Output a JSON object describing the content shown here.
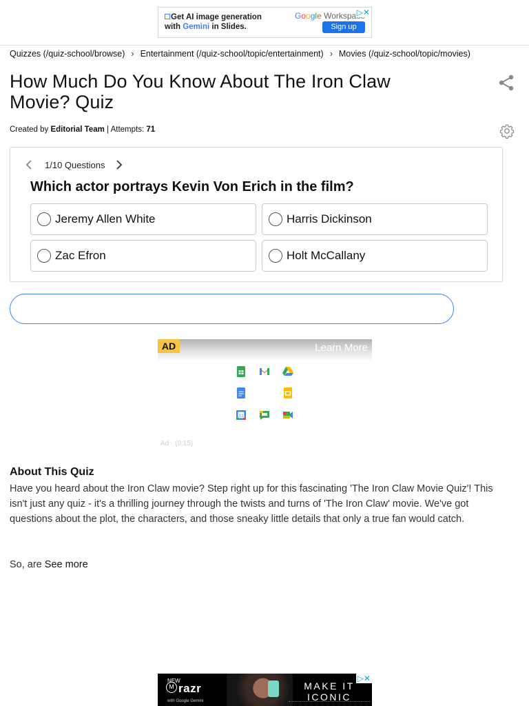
{
  "top_ad": {
    "line1": "Get AI image generation",
    "line2_a": "with ",
    "line2_gem": "Gemini",
    "line2_b": " in Slides.",
    "google_g": "G",
    "google_o1": "o",
    "google_o2": "o",
    "google_g2": "g",
    "google_l": "l",
    "google_e": "e",
    "workspace": " Workspace",
    "button": "Sign up",
    "choices": "▷✕"
  },
  "breadcrumb": {
    "items": [
      "Quizzes (/quiz-school/browse)",
      "Entertainment (/quiz-school/topic/entertainment)",
      "Movies (/quiz-school/topic/movies)"
    ],
    "separator": "›"
  },
  "title": "How Much Do You Know About The Iron Claw Movie? Quiz",
  "meta": {
    "created_by": "Created by ",
    "author": "Editorial Team",
    "attempts_label": " | Attempts: ",
    "attempts": "71"
  },
  "quiz": {
    "counter": "1/10 Questions",
    "question": "Which actor portrays Kevin Von Erich in the film?",
    "options": [
      "Jeremy Allen White",
      "Harris Dickinson",
      "Zac Efron",
      "Holt McCallany"
    ]
  },
  "video_ad": {
    "badge": "AD",
    "learn_more": "Learn More",
    "timer": "Ad · (0:15)"
  },
  "about": {
    "title": "About This Quiz",
    "body": "Have you heard about the Iron Claw movie? Step right up for this fascinating 'The Iron Claw Movie Quiz'! This isn't just any quiz - it's a thrilling journey through the twists and turns of 'The Iron Claw' movie. We've got questions about the plot, the characters, and those sneaky little details that only a true fan would catch.",
    "tail": "So, are ",
    "see_more": "See more"
  },
  "bottom_ad": {
    "new_label": "NEW",
    "brand": "razr",
    "logo": "M",
    "with": "with Google Gemini",
    "headline_1": "MAKE IT",
    "headline_2": "ICONIC",
    "choices": "▷✕"
  },
  "colors": {
    "accent_blue": "#3b82f6",
    "ad_badge": "#f6c445",
    "signup_blue": "#1a73e8"
  },
  "icons": [
    "share-icon",
    "gear-icon",
    "chevron-left-icon",
    "chevron-right-icon",
    "radio-icon",
    "adchoices-icon"
  ]
}
